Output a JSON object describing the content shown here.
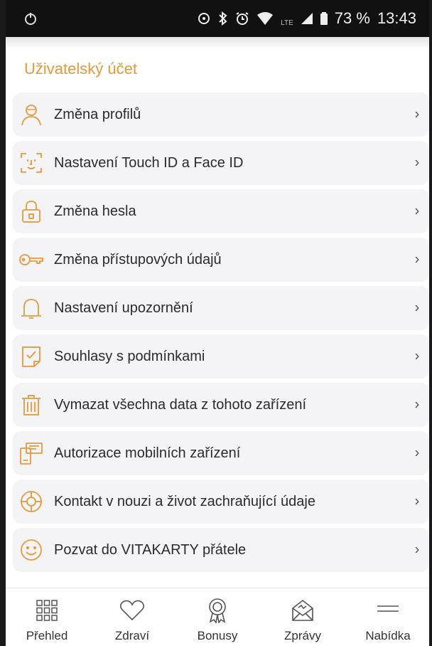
{
  "status_bar": {
    "battery": "73 %",
    "time": "13:43",
    "network": "LTE",
    "icons": [
      "app-notification-icon",
      "sync-icon",
      "bluetooth-icon",
      "alarm-icon",
      "wifi-icon",
      "lte-icon",
      "signal-icon",
      "battery-icon"
    ]
  },
  "section": {
    "title": "Uživatelský účet"
  },
  "menu": {
    "accent_color": "#e59a3a",
    "items": [
      {
        "label": "Změna profilů",
        "icon": "profile-icon"
      },
      {
        "label": "Nastavení Touch ID a Face ID",
        "icon": "face-id-icon"
      },
      {
        "label": "Změna hesla",
        "icon": "lock-icon"
      },
      {
        "label": "Změna přístupových údajů",
        "icon": "key-icon"
      },
      {
        "label": "Nastavení upozornění",
        "icon": "bell-icon"
      },
      {
        "label": "Souhlasy s podmínkami",
        "icon": "checked-document-icon"
      },
      {
        "label": "Vymazat všechna data z tohoto zařízení",
        "icon": "trash-icon"
      },
      {
        "label": "Autorizace mobilních zařízení",
        "icon": "devices-icon"
      },
      {
        "label": "Kontakt v nouzi a život zachraňující údaje",
        "icon": "lifebuoy-icon"
      },
      {
        "label": "Pozvat do VITAKARTY přátele",
        "icon": "smiley-icon"
      }
    ],
    "chevron": "›"
  },
  "bottom_nav": {
    "items": [
      {
        "label": "Přehled",
        "icon": "grid-icon"
      },
      {
        "label": "Zdraví",
        "icon": "heart-icon"
      },
      {
        "label": "Bonusy",
        "icon": "award-icon"
      },
      {
        "label": "Zprávy",
        "icon": "envelope-icon"
      },
      {
        "label": "Nabídka",
        "icon": "hamburger-icon"
      }
    ]
  }
}
